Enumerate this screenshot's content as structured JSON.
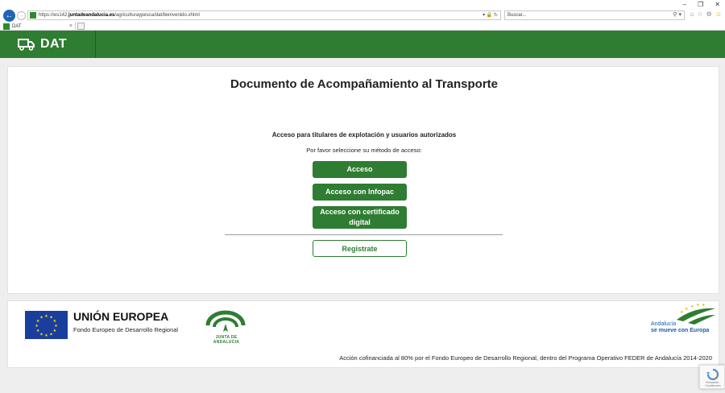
{
  "browser": {
    "url_prefix": "https://ws142.",
    "url_domain": "juntadeandalucia.es",
    "url_path": "/agriculturaypesca/dat/bienvenido.xhtml",
    "search_placeholder": "Buscar...",
    "tab_title": "DAT"
  },
  "header": {
    "app_name": "DAT"
  },
  "main": {
    "title": "Documento de Acompañamiento al Transporte",
    "access_heading": "Acceso para titulares de explotación y usuarios autorizados",
    "access_sub": "Por favor seleccione su método de acceso:",
    "btn_access": "Acceso",
    "btn_infopac": "Acceso con Infopac",
    "btn_cert": "Acceso con certificado digital",
    "btn_register": "Registrate"
  },
  "footer": {
    "eu_title": "UNIÓN EUROPEA",
    "eu_sub": "Fondo Europeo de Desarrollo Regional",
    "junta_text": "JUNTA DE ANDALUCIA",
    "andalucia_line1": "Andalucía",
    "andalucia_line2": "se mueve con Europa",
    "cofin": "Acción cofinanciada al 80% por el Fondo Europeo de Desarrollo Regional, dentro del Programa Operativo FEDER de Andalucía 2014-2020"
  },
  "recaptcha": {
    "label": "Privacidad - Condiciones"
  },
  "colors": {
    "brand_green": "#2e7d32",
    "eu_blue": "#1a3e9e",
    "browser_blue": "#1f63b3"
  },
  "icons": [
    "back-icon",
    "forward-icon",
    "lock-icon",
    "refresh-icon",
    "search-icon",
    "home-icon",
    "star-icon",
    "gear-icon",
    "smiley-icon",
    "truck-icon",
    "eu-flag-icon",
    "recaptcha-icon"
  ]
}
